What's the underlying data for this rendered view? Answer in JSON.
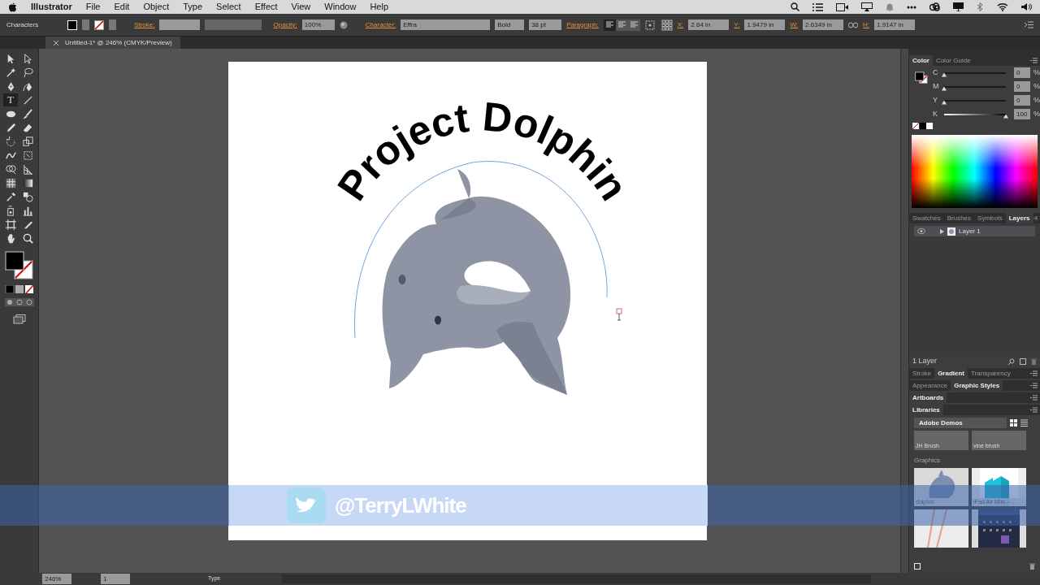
{
  "menu_bar": {
    "app": "Illustrator",
    "items": [
      "File",
      "Edit",
      "Object",
      "Type",
      "Select",
      "Effect",
      "View",
      "Window",
      "Help"
    ]
  },
  "control_bar": {
    "selection": "Characters",
    "stroke_label": "Stroke:",
    "opacity_label": "Opacity:",
    "opacity": "100%",
    "character_label": "Character:",
    "font": "Effra",
    "style": "Bold",
    "size": "38 pt",
    "paragraph_label": "Paragraph:",
    "align": [
      {
        "selected": true
      },
      {
        "selected": false
      },
      {
        "selected": false
      }
    ],
    "fields": [
      {
        "label": "X:",
        "value": "2.64 in"
      },
      {
        "label": "Y:",
        "value": "1.9479 in"
      },
      {
        "label": "W:",
        "value": "2.6349 in"
      },
      {
        "label": "H:",
        "value": "1.9147 in"
      }
    ]
  },
  "document_tab": {
    "title": "Untitled-1* @ 246% (CMYK/Preview)"
  },
  "tools": [
    {
      "kind": "select",
      "selected": false
    },
    {
      "kind": "direct",
      "selected": false
    },
    {
      "kind": "wand",
      "selected": false
    },
    {
      "kind": "lasso",
      "selected": false
    },
    {
      "kind": "pen",
      "selected": false
    },
    {
      "kind": "curvature",
      "selected": false
    },
    {
      "kind": "type",
      "glyph": "T",
      "selected": true
    },
    {
      "kind": "line",
      "selected": false
    },
    {
      "kind": "ellipse",
      "selected": false
    },
    {
      "kind": "brush",
      "selected": false
    },
    {
      "kind": "pencil",
      "selected": false
    },
    {
      "kind": "eraser",
      "selected": false
    },
    {
      "kind": "rotate",
      "selected": false
    },
    {
      "kind": "scale",
      "selected": false
    },
    {
      "kind": "warp",
      "selected": false
    },
    {
      "kind": "transform",
      "selected": false
    },
    {
      "kind": "builder",
      "selected": false
    },
    {
      "kind": "perspective",
      "selected": false
    },
    {
      "kind": "mesh",
      "selected": false
    },
    {
      "kind": "gradient",
      "selected": false
    },
    {
      "kind": "eyedropper",
      "selected": false
    },
    {
      "kind": "blend",
      "selected": false
    },
    {
      "kind": "symbol",
      "selected": false
    },
    {
      "kind": "graph",
      "selected": false
    },
    {
      "kind": "artboard",
      "selected": false
    },
    {
      "kind": "slice",
      "selected": false
    },
    {
      "kind": "hand",
      "selected": false
    },
    {
      "kind": "zoom",
      "selected": false
    }
  ],
  "artboard": {
    "title": "Project Dolphin"
  },
  "color_panel": {
    "tabs": [
      {
        "label": "Color",
        "selected": true
      },
      {
        "label": "Color Guide",
        "selected": false
      }
    ],
    "sliders": [
      {
        "label": "C",
        "value": "0",
        "unit": "%",
        "level": 0
      },
      {
        "label": "M",
        "value": "0",
        "unit": "%",
        "level": 0
      },
      {
        "label": "Y",
        "value": "0",
        "unit": "%",
        "level": 0
      },
      {
        "label": "K",
        "value": "100",
        "unit": "%",
        "level": 1
      }
    ]
  },
  "layers_panel": {
    "tabs": [
      {
        "label": "Swatches",
        "selected": false
      },
      {
        "label": "Brushes",
        "selected": false
      },
      {
        "label": "Symbols",
        "selected": false
      },
      {
        "label": "Layers",
        "selected": true
      }
    ],
    "layers": [
      {
        "name": "Layer 1",
        "visible": true
      }
    ],
    "count": "1 Layer"
  },
  "panel_groups": [
    [
      {
        "label": "Stroke",
        "selected": false
      },
      {
        "label": "Gradient",
        "selected": true
      },
      {
        "label": "Transparency",
        "selected": false
      }
    ],
    [
      {
        "label": "Appearance",
        "selected": false
      },
      {
        "label": "Graphic Styles",
        "selected": true
      }
    ],
    [
      {
        "label": "Artboards",
        "selected": true
      }
    ],
    [
      {
        "label": "Libraries",
        "selected": true
      }
    ]
  ],
  "library": {
    "library": "Adobe Demos",
    "brushes": [
      "JH Brush",
      "vine brush"
    ],
    "section": "Graphics",
    "graphics": [
      {
        "kind": "dolphin",
        "label": "dolphin"
      },
      {
        "kind": "ipad",
        "label": "iPad Air Mini – ..."
      },
      {
        "kind": "pencils"
      },
      {
        "kind": "calendar"
      }
    ]
  },
  "status_bar": {
    "zoom": "246%",
    "page": "1",
    "tool": "Type"
  },
  "overlay": {
    "handle": "@TerryLWhite"
  }
}
